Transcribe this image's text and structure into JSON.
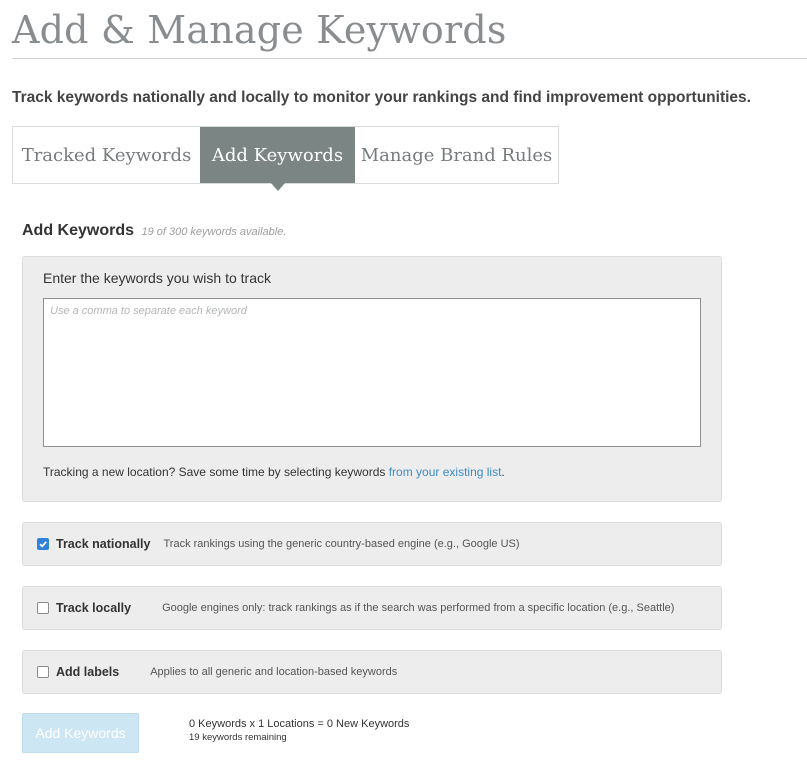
{
  "page": {
    "title": "Add & Manage Keywords",
    "subtitle": "Track keywords nationally and locally to monitor your rankings and find improvement opportunities."
  },
  "tabs": [
    {
      "label": "Tracked Keywords",
      "active": false
    },
    {
      "label": "Add Keywords",
      "active": true
    },
    {
      "label": "Manage Brand Rules",
      "active": false
    }
  ],
  "section": {
    "heading": "Add Keywords",
    "availability": "19 of 300 keywords available."
  },
  "keywords_panel": {
    "label": "Enter the keywords you wish to track",
    "placeholder": "Use a comma to separate each keyword",
    "value": "",
    "hint": "Tracking a new location? Save some time by selecting keywords ",
    "hint_link": "from your existing list",
    "hint_end": "."
  },
  "options": [
    {
      "name": "Track nationally",
      "description": "Track rankings using the generic country-based engine (e.g., Google US)",
      "checked": true
    },
    {
      "name": "Track locally",
      "description": "Google engines only: track rankings as if the search was performed from a specific location (e.g., Seattle)",
      "checked": false
    },
    {
      "name": "Add labels",
      "description": "Applies to all generic and location-based keywords",
      "checked": false
    }
  ],
  "footer": {
    "button_label": "Add Keywords",
    "summary": "0 Keywords x 1 Locations = 0 New Keywords",
    "remaining": "19 keywords remaining"
  },
  "colors": {
    "active_tab": "#7a8584",
    "checkbox_checked": "#2f84d9",
    "link": "#3d8cc8",
    "button_disabled": "#cde6f4"
  },
  "icons": {
    "checkmark": "check-icon"
  }
}
